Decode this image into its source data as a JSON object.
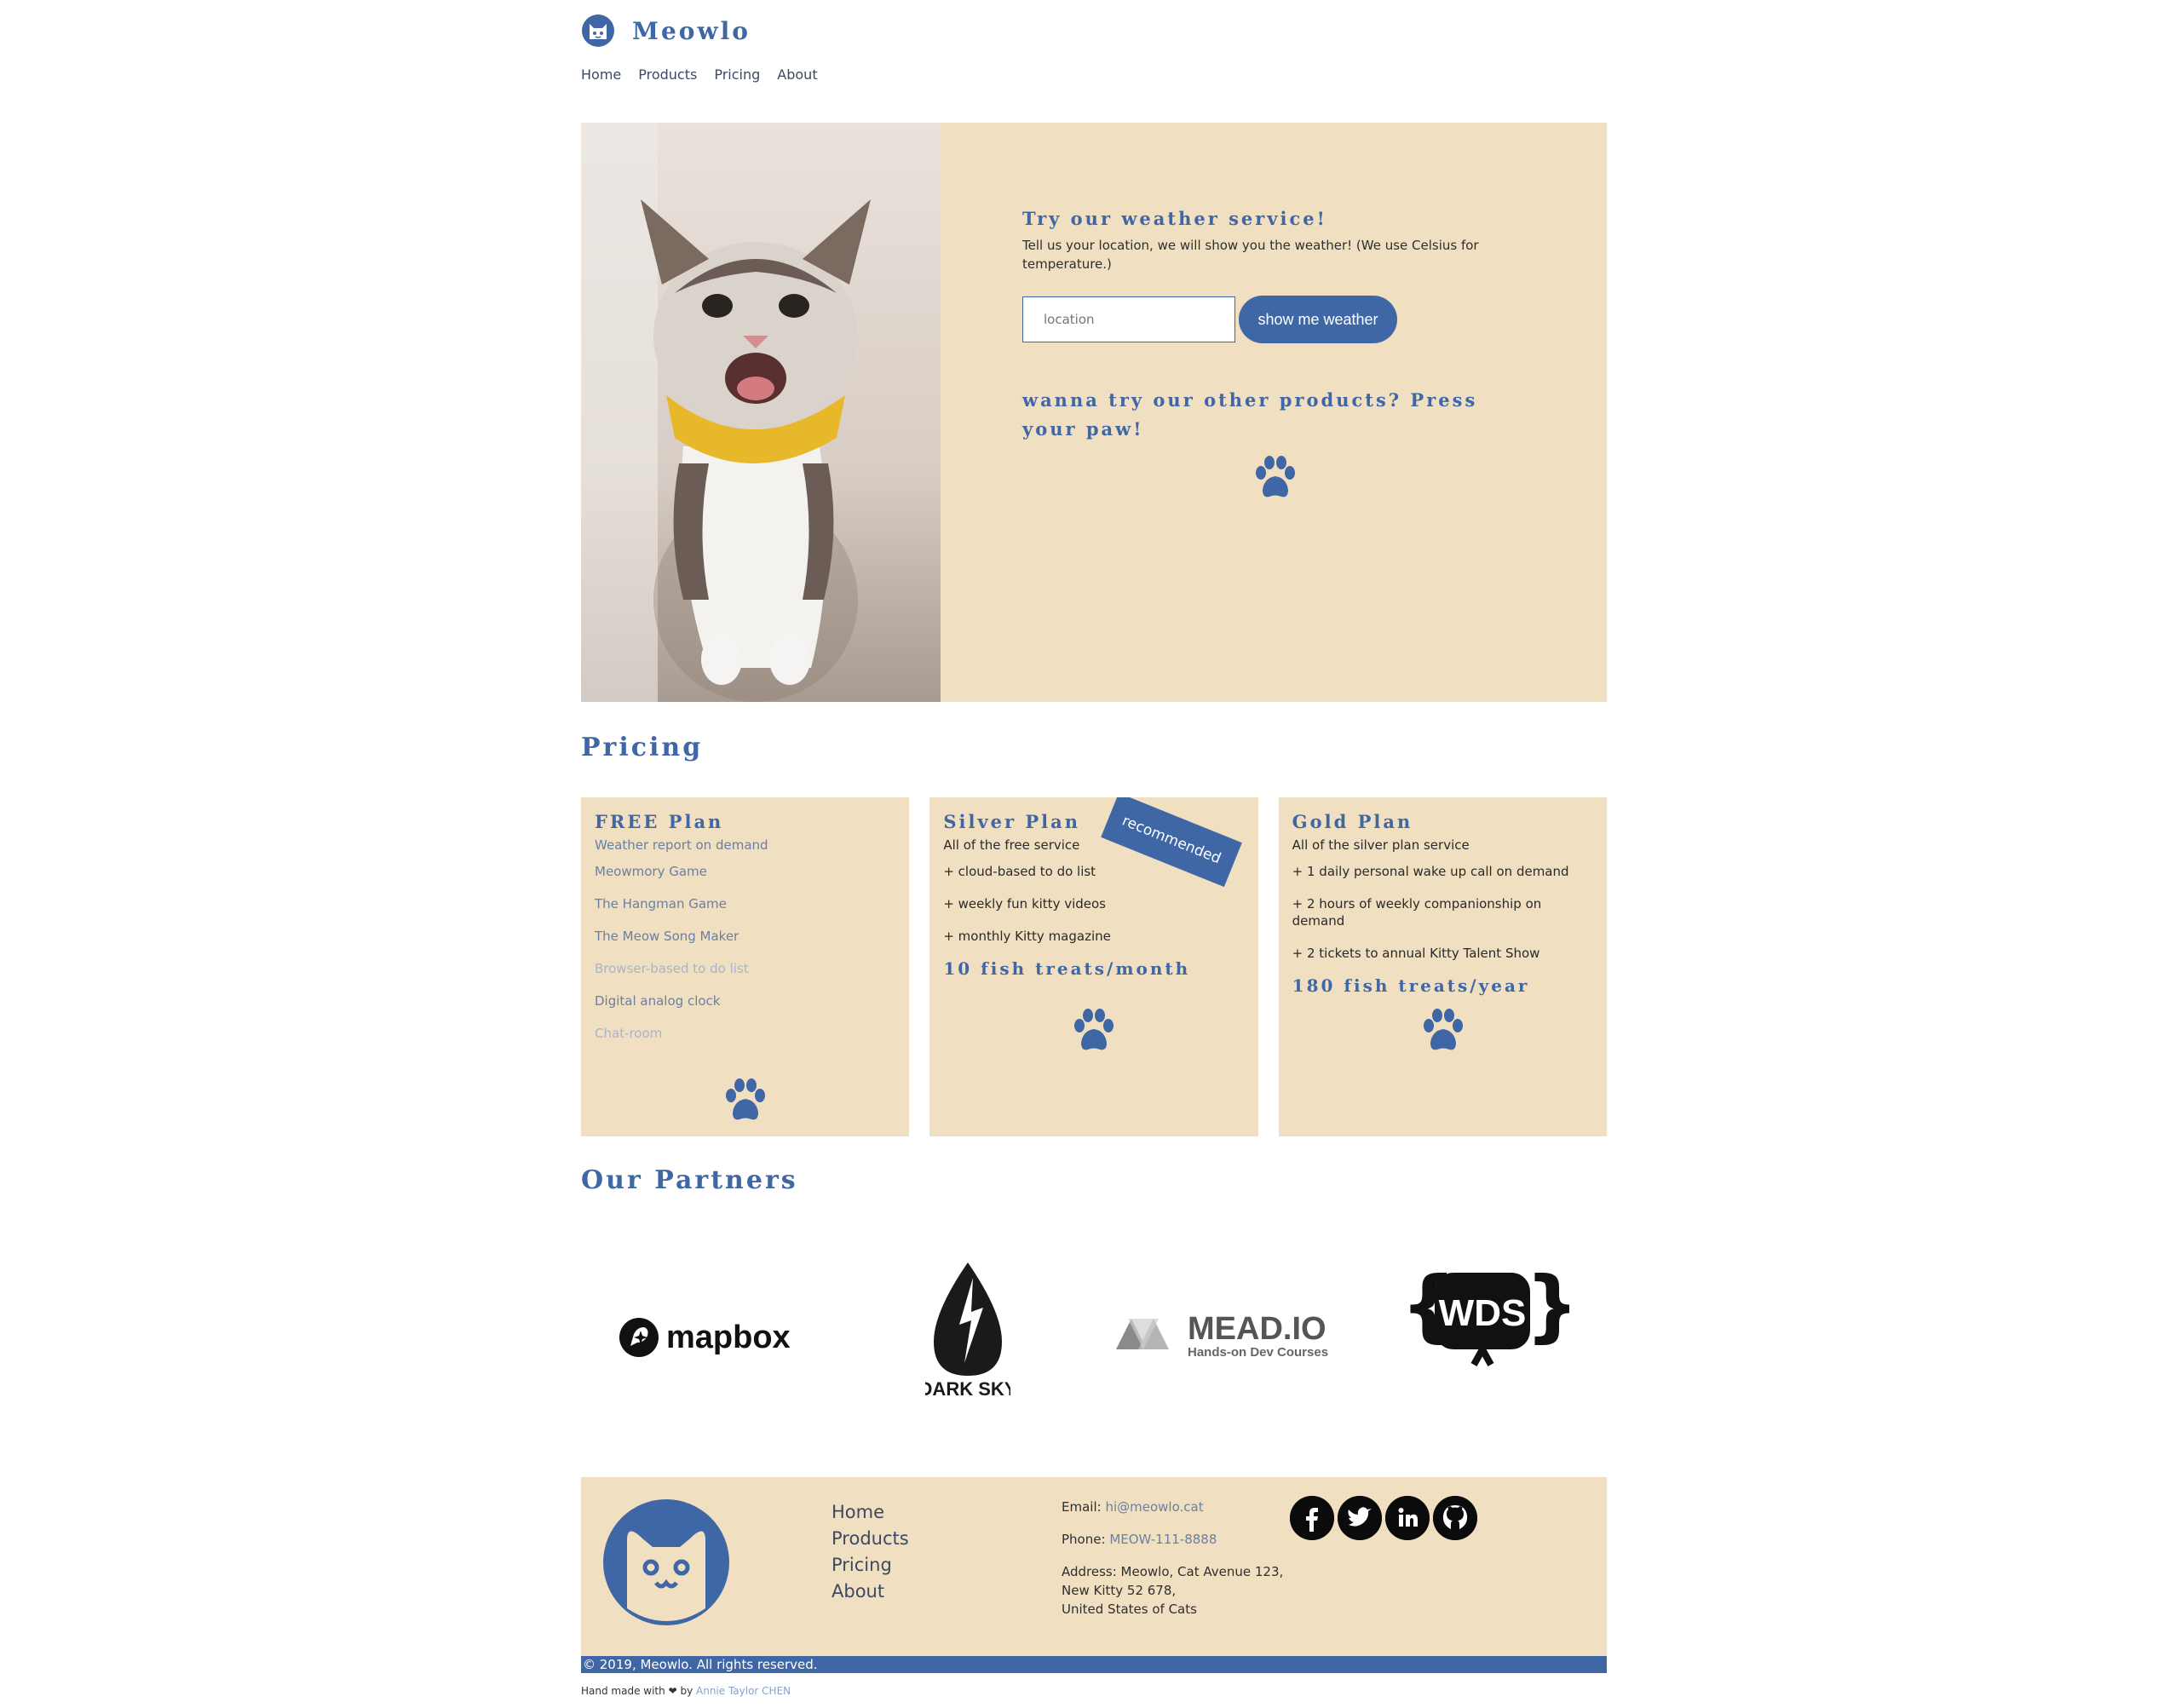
{
  "brand": {
    "name": "Meowlo"
  },
  "nav": {
    "items": [
      "Home",
      "Products",
      "Pricing",
      "About"
    ]
  },
  "hero": {
    "title": "Try our weather service!",
    "description": "Tell us your location, we will show you the weather! (We use Celsius for temperature.)",
    "input_placeholder": "location",
    "button_label": "show me weather",
    "products_prompt": "wanna try our other products? Press your paw!"
  },
  "pricing": {
    "title": "Pricing",
    "plans": [
      {
        "title": "FREE Plan",
        "subtitle": "Weather report on demand",
        "items": [
          "Meowmory Game",
          "The Hangman Game",
          "The Meow Song Maker",
          "Browser-based to do list",
          "Digital analog clock",
          "Chat-room"
        ],
        "price": ""
      },
      {
        "title": "Silver Plan",
        "subtitle": "All of the free service",
        "items": [
          "+ cloud-based to do list",
          "+ weekly fun kitty videos",
          "+ monthly Kitty magazine"
        ],
        "price": "10 fish treats/month",
        "ribbon": "recommended"
      },
      {
        "title": "Gold Plan",
        "subtitle": "All of the silver plan service",
        "items": [
          "+ 1 daily personal wake up call on demand",
          "+ 2 hours of weekly companionship on demand",
          "+ 2 tickets to annual Kitty Talent Show"
        ],
        "price": "180 fish treats/year"
      }
    ]
  },
  "partners": {
    "title": "Our Partners",
    "logos": [
      {
        "name": "mapbox",
        "text": "mapbox"
      },
      {
        "name": "dark-sky",
        "text": "DARK SKY"
      },
      {
        "name": "mead-io",
        "text": "MEAD.IO",
        "subtext": "Hands-on Dev Courses"
      },
      {
        "name": "wds",
        "text": "WDS"
      }
    ]
  },
  "footer": {
    "nav": [
      "Home",
      "Products",
      "Pricing",
      "About"
    ],
    "email_label": "Email:",
    "email": "hi@meowlo.cat",
    "phone_label": "Phone:",
    "phone": "MEOW-111-8888",
    "address_line1": "Address: Meowlo, Cat Avenue 123,",
    "address_line2": "New Kitty 52 678,",
    "address_line3": "United States of Cats",
    "socials": [
      "facebook-icon",
      "twitter-icon",
      "linkedin-icon",
      "github-icon"
    ],
    "copyright": "© 2019, Meowlo. All rights reserved."
  },
  "credit": {
    "prefix": "Hand made with",
    "heart": "❤",
    "by": "by",
    "author": "Annie Taylor CHEN"
  },
  "colors": {
    "accent": "#3f67a6",
    "cream": "#f0dfc0",
    "text": "#2a2a2a"
  }
}
